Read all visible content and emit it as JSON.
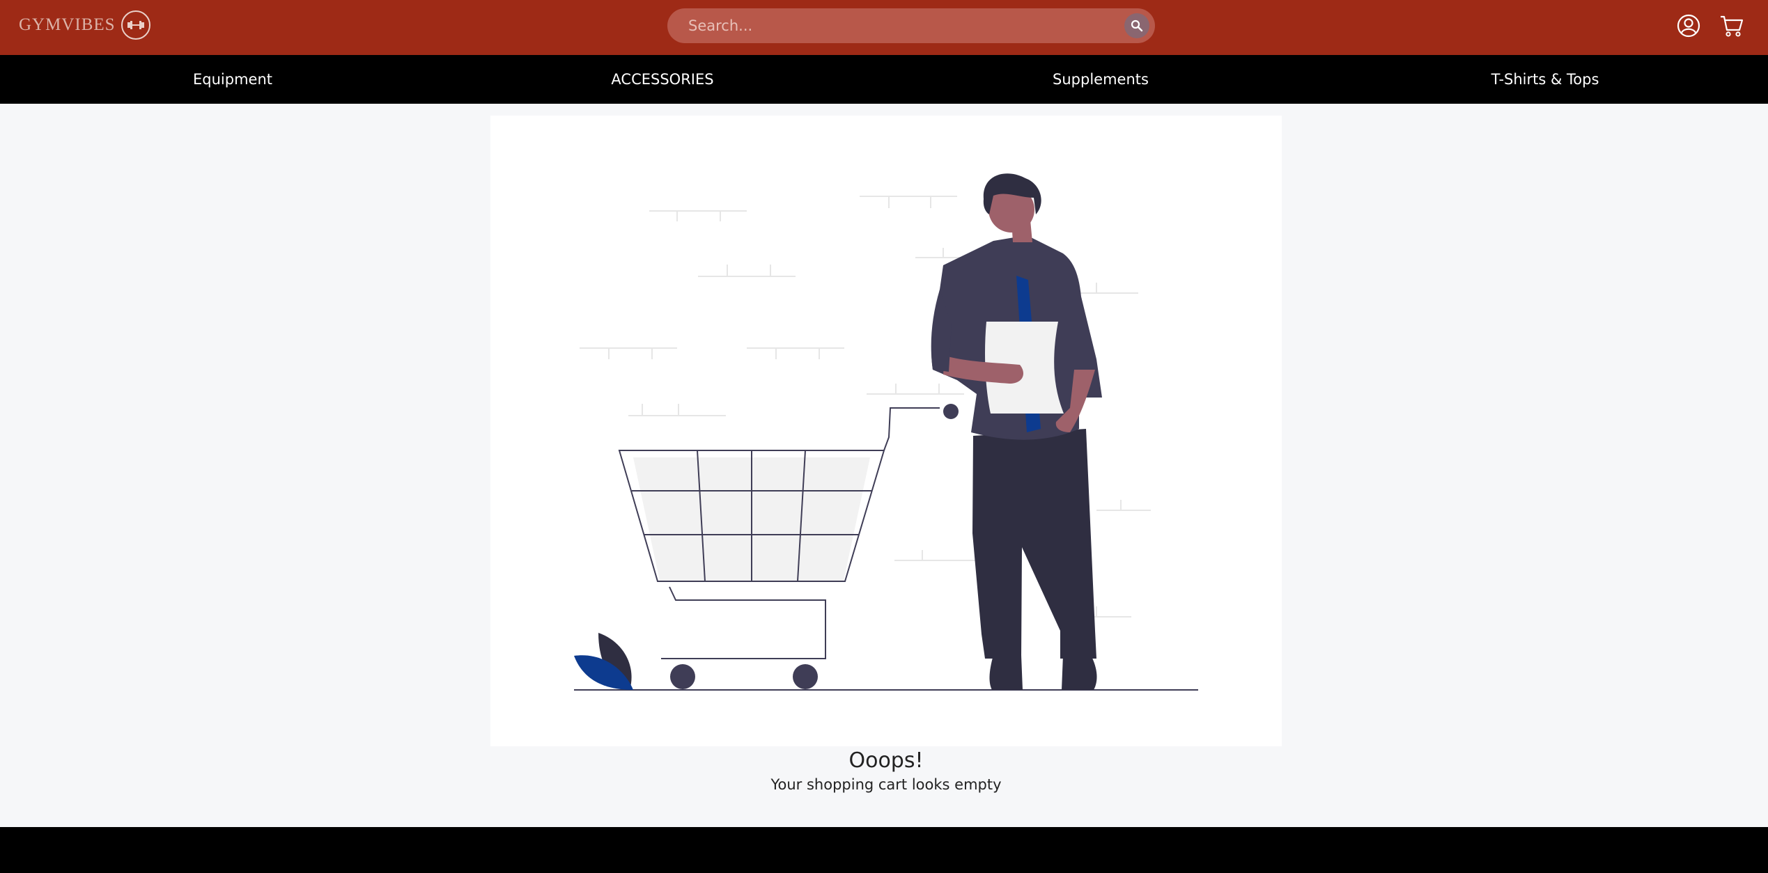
{
  "brand": {
    "name": "GYMVIBES",
    "accent": "#9e2a16"
  },
  "search": {
    "placeholder": "Search...",
    "icon": "search-icon"
  },
  "header_icons": [
    "user-icon",
    "cart-icon"
  ],
  "categories": [
    {
      "label": "Equipment"
    },
    {
      "label": "ACCESSORIES"
    },
    {
      "label": "Supplements"
    },
    {
      "label": "T-Shirts & Tops"
    }
  ],
  "empty_cart": {
    "title": "Ooops!",
    "message": "Your shopping cart looks empty",
    "illustration": "person-with-empty-cart"
  },
  "colors": {
    "header_bg": "#9e2a16",
    "nav_bg": "#000000",
    "page_bg": "#f6f7f9",
    "footer_bg": "#000000"
  }
}
